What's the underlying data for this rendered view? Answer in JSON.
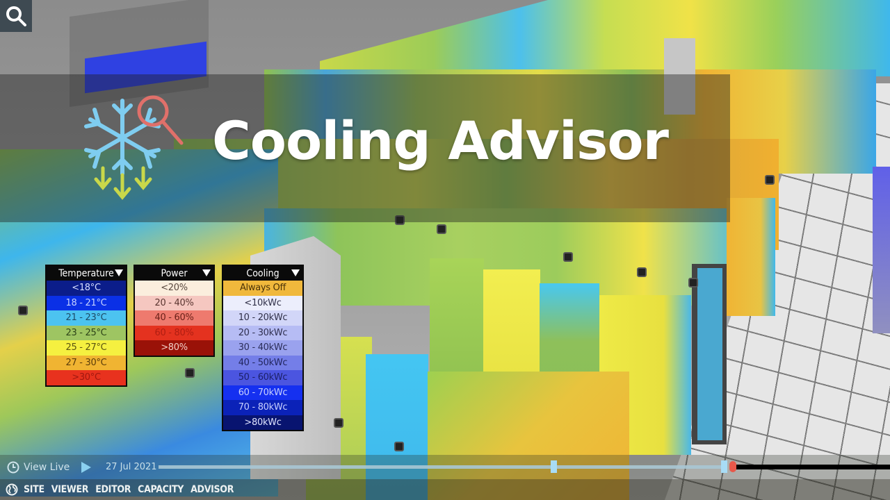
{
  "banner": {
    "title": "Cooling Advisor",
    "icon": "snowflake-search-icon"
  },
  "search": {
    "icon": "search-icon"
  },
  "legends": {
    "temperature": {
      "title": "Temperature",
      "rows": [
        {
          "label": "<18°C",
          "bg": "#0b1d8a",
          "fg": "#d6ddff"
        },
        {
          "label": "18 - 21°C",
          "bg": "#0a30e6",
          "fg": "#c7d2ff"
        },
        {
          "label": "21 - 23°C",
          "bg": "#4cc3f0",
          "fg": "#1d4a66"
        },
        {
          "label": "23 - 25°C",
          "bg": "#9ec562",
          "fg": "#2d4418"
        },
        {
          "label": "25 - 27°C",
          "bg": "#f5f040",
          "fg": "#5a5410"
        },
        {
          "label": "27 - 30°C",
          "bg": "#f0b432",
          "fg": "#5a3c0a"
        },
        {
          "label": ">30°C",
          "bg": "#e8321e",
          "fg": "#a01810"
        }
      ]
    },
    "power": {
      "title": "Power",
      "rows": [
        {
          "label": "<20%",
          "bg": "#fbeedd",
          "fg": "#5a4a40"
        },
        {
          "label": "20 - 40%",
          "bg": "#f5c7c0",
          "fg": "#5a3530"
        },
        {
          "label": "40 - 60%",
          "bg": "#ee7a6e",
          "fg": "#6a2018"
        },
        {
          "label": "60 - 80%",
          "bg": "#e4321f",
          "fg": "#b01e12"
        },
        {
          "label": ">80%",
          "bg": "#9a1208",
          "fg": "#f2d0c8"
        }
      ]
    },
    "cooling": {
      "title": "Cooling",
      "rows": [
        {
          "label": "Always Off",
          "bg": "#f0b83c",
          "fg": "#4a3208"
        },
        {
          "label": "<10kWc",
          "bg": "#eceefc",
          "fg": "#303048"
        },
        {
          "label": "10 - 20kWc",
          "bg": "#d2d6f8",
          "fg": "#303048"
        },
        {
          "label": "20 - 30kWc",
          "bg": "#b6bcf4",
          "fg": "#303050"
        },
        {
          "label": "30 - 40kWc",
          "bg": "#9aa2ee",
          "fg": "#2a2c58"
        },
        {
          "label": "40 - 50kWc",
          "bg": "#747ee8",
          "fg": "#22265e"
        },
        {
          "label": "50 - 60kWc",
          "bg": "#4b55e0",
          "fg": "#1c2068"
        },
        {
          "label": "60 - 70kWc",
          "bg": "#1530f0",
          "fg": "#c8d0ff"
        },
        {
          "label": "70 - 80kWc",
          "bg": "#0b22b8",
          "fg": "#c8d0ff"
        },
        {
          "label": ">80kWc",
          "bg": "#081470",
          "fg": "#dfe4ff"
        }
      ]
    }
  },
  "timeline": {
    "view_live": "View Live",
    "date": "27 Jul 2021",
    "play_icon": "play-icon",
    "clock_icon": "clock-icon"
  },
  "nav": {
    "items": [
      "SITE",
      "VIEWER",
      "EDITOR",
      "CAPACITY",
      "ADVISOR"
    ]
  }
}
